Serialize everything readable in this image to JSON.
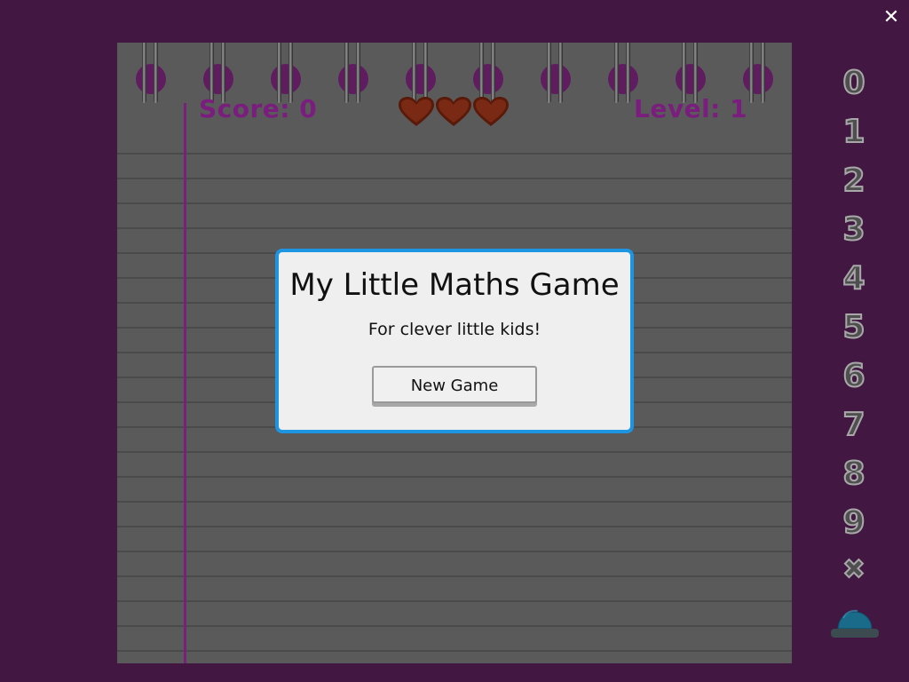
{
  "window": {
    "close_glyph": "✕"
  },
  "hud": {
    "score_label": "Score: 0",
    "level_label": "Level: 1",
    "lives": 3,
    "heart_color": "#7a2a14"
  },
  "modal": {
    "title": "My Little Maths Game",
    "subtitle": "For clever little kids!",
    "new_game_label": "New Game",
    "border_color": "#1e95e3"
  },
  "keypad": {
    "keys": [
      "0",
      "1",
      "2",
      "3",
      "4",
      "5",
      "6",
      "7",
      "8",
      "9",
      "✖"
    ],
    "submit_icon": "dome-button-icon",
    "submit_color": "#1a6a8a"
  },
  "colors": {
    "background": "#421842",
    "paper": "#5a5a5a",
    "accent_purple": "#7a1d7e"
  }
}
